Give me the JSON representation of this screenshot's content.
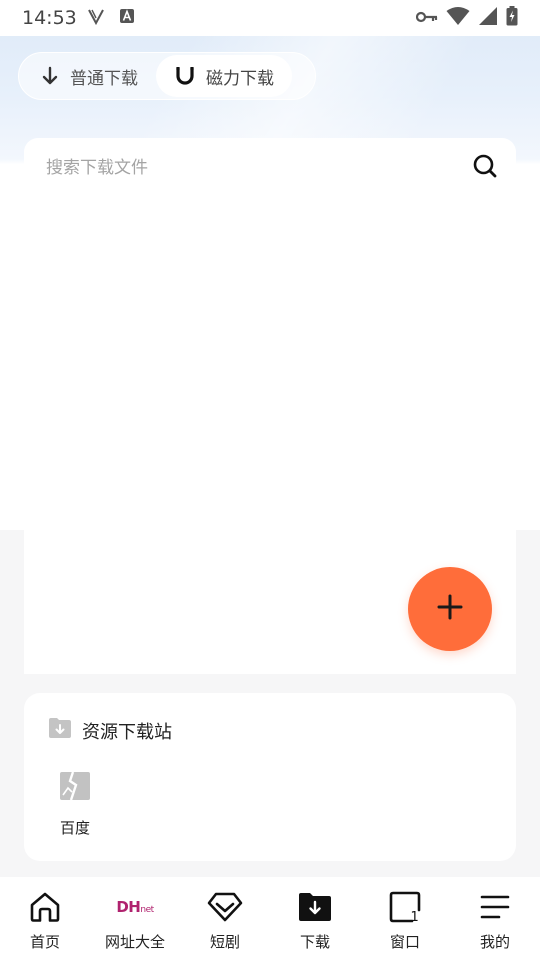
{
  "status_bar": {
    "time": "14:53",
    "icons": [
      "v-icon",
      "a-icon",
      "key-icon",
      "wifi-icon",
      "signal-icon",
      "battery-charging-icon"
    ]
  },
  "mode_toggle": {
    "normal_label": "普通下载",
    "magnet_label": "磁力下载",
    "active": "magnet"
  },
  "search": {
    "placeholder": "搜索下载文件",
    "value": ""
  },
  "fab": {
    "icon": "plus-icon",
    "color": "#ff6d3a"
  },
  "resource_section": {
    "title": "资源下载站",
    "sites": [
      {
        "label": "百度",
        "icon": "broken-image-icon"
      }
    ]
  },
  "bottom_nav": {
    "items": [
      {
        "label": "首页",
        "icon": "home-icon"
      },
      {
        "label": "网址大全",
        "icon": "dh-net-logo",
        "logo_main": "DH",
        "logo_sub": "net"
      },
      {
        "label": "短剧",
        "icon": "diamond-icon"
      },
      {
        "label": "下载",
        "icon": "download-folder-icon"
      },
      {
        "label": "窗口",
        "icon": "window-icon",
        "badge": "1"
      },
      {
        "label": "我的",
        "icon": "menu-icon"
      }
    ]
  }
}
